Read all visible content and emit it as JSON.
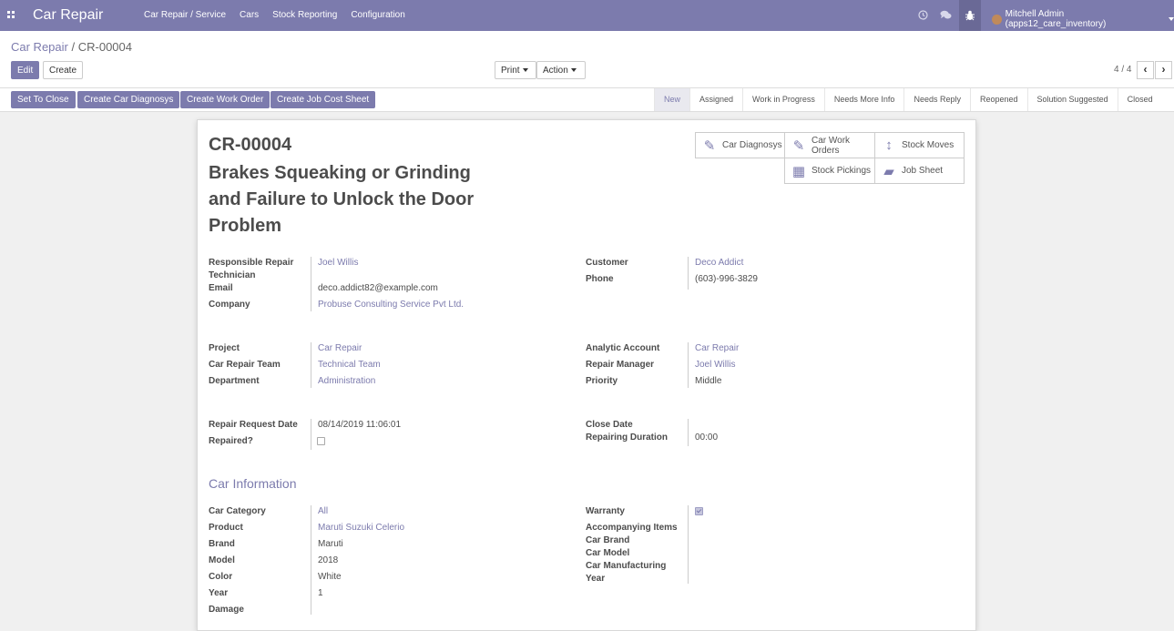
{
  "topbar": {
    "brand": "Car Repair",
    "menu": [
      "Car Repair / Service",
      "Cars",
      "Stock Reporting",
      "Configuration"
    ],
    "user": "Mitchell Admin (apps12_care_inventory)",
    "icons": [
      "apps-grid-icon",
      "clock-icon",
      "chat-icon",
      "bug-icon"
    ]
  },
  "breadcrumb": {
    "parent": "Car Repair",
    "separator": "/",
    "current": "CR-00004"
  },
  "buttons": {
    "edit": "Edit",
    "create": "Create",
    "print": "Print",
    "action": "Action"
  },
  "pager": {
    "text": "4 / 4",
    "prev": "‹",
    "next": "›"
  },
  "statusbar": {
    "buttons": [
      "Set To Close",
      "Create Car Diagnosys",
      "Create Work Order",
      "Create Job Cost Sheet"
    ],
    "stages": [
      "New",
      "Assigned",
      "Work in Progress",
      "Needs More Info",
      "Needs Reply",
      "Reopened",
      "Solution Suggested",
      "Closed"
    ],
    "active_stage": "New"
  },
  "record": {
    "id": "CR-00004",
    "title": "Brakes Squeaking or Grinding and Failure to Unlock the Door Problem"
  },
  "smart_buttons": {
    "diagnosys": "Car Diagnosys",
    "work_orders": "Car Work Orders",
    "stock_moves": "Stock Moves",
    "stock_pickings": "Stock Pickings",
    "job_sheet": "Job Sheet"
  },
  "fields": {
    "responsible_label": "Responsible Repair Technician",
    "responsible": "Joel Willis",
    "email_label": "Email",
    "email": "deco.addict82@example.com",
    "company_label": "Company",
    "company": "Probuse Consulting Service Pvt Ltd.",
    "customer_label": "Customer",
    "customer": "Deco Addict",
    "phone_label": "Phone",
    "phone": "(603)-996-3829",
    "project_label": "Project",
    "project": "Car Repair",
    "team_label": "Car Repair Team",
    "team": "Technical Team",
    "department_label": "Department",
    "department": "Administration",
    "analytic_label": "Analytic Account",
    "analytic": "Car Repair",
    "manager_label": "Repair Manager",
    "manager": "Joel Willis",
    "priority_label": "Priority",
    "priority": "Middle",
    "request_date_label": "Repair Request Date",
    "request_date": "08/14/2019 11:06:01",
    "repaired_label": "Repaired?",
    "repaired": false,
    "close_date_label": "Close Date",
    "close_date": "",
    "duration_label": "Repairing Duration",
    "duration": "00:00"
  },
  "car_info": {
    "title": "Car Information",
    "category_label": "Car Category",
    "category": "All",
    "product_label": "Product",
    "product": "Maruti Suzuki Celerio",
    "brand_label": "Brand",
    "brand": "Maruti",
    "model_label": "Model",
    "model": "2018",
    "color_label": "Color",
    "color": "White",
    "year_label": "Year",
    "year": "1",
    "damage_label": "Damage",
    "warranty_label": "Warranty",
    "warranty": true,
    "accompanying_label": "Accompanying Items",
    "car_brand_label": "Car Brand",
    "car_model_label": "Car Model",
    "car_year_label": "Car Manufacturing Year"
  },
  "colors": {
    "accent": "#7c7bad",
    "topbar": "#7c7bad",
    "background": "#f0f0f0"
  }
}
